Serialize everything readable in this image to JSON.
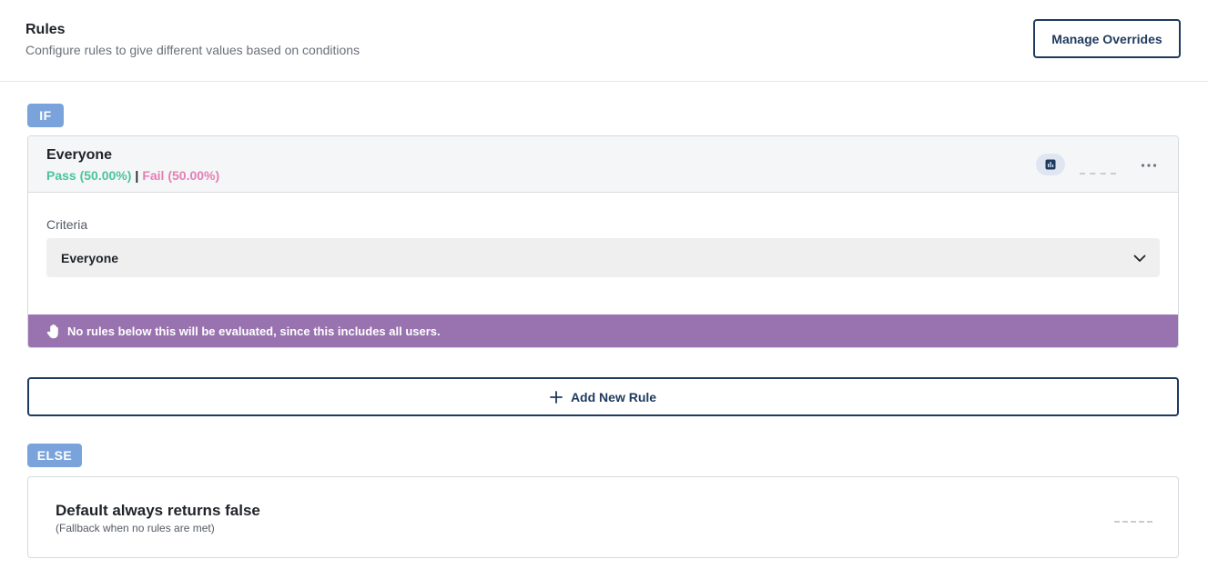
{
  "header": {
    "title": "Rules",
    "subtitle": "Configure rules to give different values based on conditions",
    "manage_overrides_label": "Manage Overrides"
  },
  "if_badge": "IF",
  "else_badge": "ELSE",
  "rule": {
    "name": "Everyone",
    "pass_text": "Pass (50.00%)",
    "separator": "|",
    "fail_text": "Fail (50.00%)",
    "icons": [
      "bar-chart-icon",
      "more-horizontal-icon"
    ],
    "criteria_label": "Criteria",
    "criteria_value": "Everyone",
    "warning": "No rules below this will be evaluated, since this includes all users.",
    "warning_icon": "hand-stop-icon"
  },
  "add_rule_label": "Add New Rule",
  "default": {
    "title": "Default always returns false",
    "subtitle": "(Fallback when no rules are met)"
  },
  "colors": {
    "brand_navy": "#1e3a5f",
    "badge_blue": "#7aa3dc",
    "pass_green": "#4cc49a",
    "fail_pink": "#e37fb4",
    "warning_purple": "#9973b0"
  }
}
